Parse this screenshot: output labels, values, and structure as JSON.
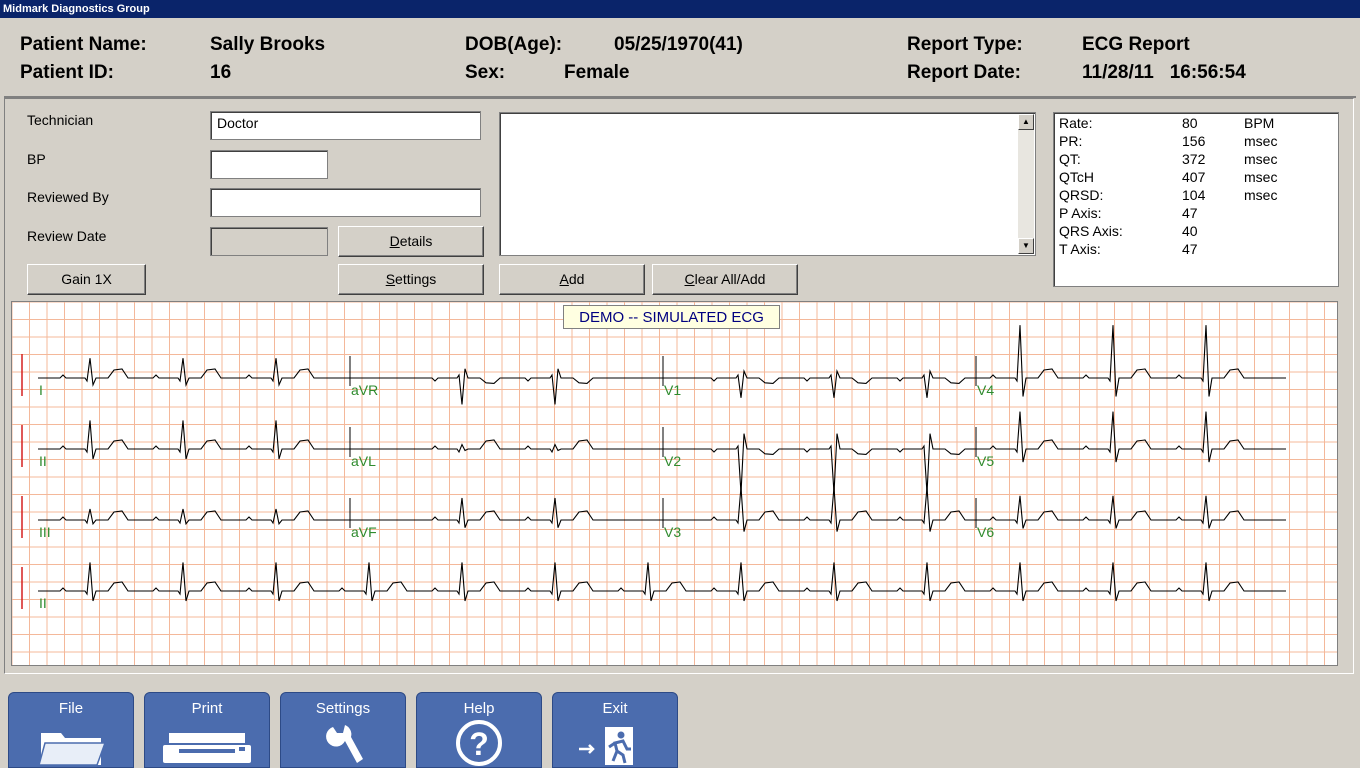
{
  "window": {
    "title": "Midmark Diagnostics Group"
  },
  "header": {
    "patient_name_label": "Patient Name:",
    "patient_name": "Sally Brooks",
    "patient_id_label": "Patient ID:",
    "patient_id": "16",
    "dob_label": "DOB(Age):",
    "dob": "05/25/1970(41)",
    "sex_label": "Sex:",
    "sex": "Female",
    "report_type_label": "Report Type:",
    "report_type": "ECG Report",
    "report_date_label": "Report Date:",
    "report_date": "11/28/11   16:56:54"
  },
  "form": {
    "technician_label": "Technician",
    "technician_value": "Doctor",
    "bp_label": "BP",
    "bp_value": "",
    "reviewed_by_label": "Reviewed By",
    "reviewed_by_value": "",
    "review_date_label": "Review Date",
    "review_date_value": ""
  },
  "buttons": {
    "details_pre": "",
    "details_u": "D",
    "details_post": "etails",
    "gain": "Gain 1X",
    "settings_pre": "",
    "settings_u": "S",
    "settings_post": "ettings",
    "add_pre": "",
    "add_u": "A",
    "add_post": "dd",
    "clear_pre": "",
    "clear_u": "C",
    "clear_post": "lear All/Add"
  },
  "notes": {
    "text": ""
  },
  "measurements": [
    {
      "label": "Rate:",
      "value": "80",
      "unit": "BPM"
    },
    {
      "label": "PR:",
      "value": "156",
      "unit": "msec"
    },
    {
      "label": "QT:",
      "value": "372",
      "unit": "msec"
    },
    {
      "label": "QTcH",
      "value": "407",
      "unit": "msec"
    },
    {
      "label": "QRSD:",
      "value": "104",
      "unit": "msec"
    },
    {
      "label": "P Axis:",
      "value": "47",
      "unit": ""
    },
    {
      "label": "QRS Axis:",
      "value": "40",
      "unit": ""
    },
    {
      "label": "T Axis:",
      "value": "47",
      "unit": ""
    }
  ],
  "ecg": {
    "banner": "DEMO -- SIMULATED ECG",
    "grid_color": "#f4b89a",
    "trace_color": "#000000",
    "lead_label_color": "#2e8b2e",
    "calibration_color": "#d42020",
    "leads": [
      [
        "I",
        "aVR",
        "V1",
        "V4"
      ],
      [
        "II",
        "aVL",
        "V2",
        "V5"
      ],
      [
        "III",
        "aVF",
        "V3",
        "V6"
      ],
      [
        "II"
      ]
    ]
  },
  "toolbar": [
    {
      "label": "File",
      "icon": "folder-icon"
    },
    {
      "label": "Print",
      "icon": "printer-icon"
    },
    {
      "label": "Settings",
      "icon": "wrench-icon"
    },
    {
      "label": "Help",
      "icon": "question-icon"
    },
    {
      "label": "Exit",
      "icon": "exit-icon"
    }
  ],
  "colors": {
    "title_bar": "#0a246a",
    "toolbar_button": "#4b6cae",
    "window_bg": "#d4d0c8"
  }
}
